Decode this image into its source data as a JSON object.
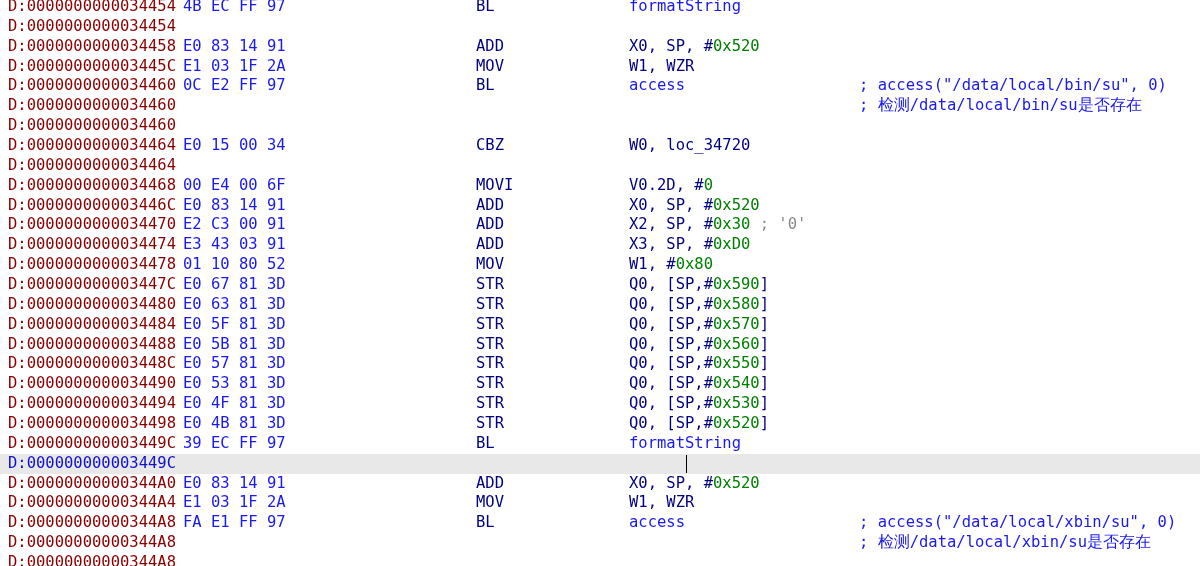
{
  "listing": {
    "rows": [
      {
        "address": "D:0000000000034454",
        "selected": false,
        "bytes": "4B EC FF 97",
        "mnemonic": "BL",
        "operands": [
          {
            "text": "formatString",
            "kind": "name"
          }
        ]
      },
      {
        "address": "D:0000000000034454",
        "selected": false
      },
      {
        "address": "D:0000000000034458",
        "selected": false,
        "bytes": "E0 83 14 91",
        "mnemonic": "ADD",
        "operands": [
          {
            "text": "X0, SP, #",
            "kind": "reg"
          },
          {
            "text": "0x520",
            "kind": "imm"
          }
        ]
      },
      {
        "address": "D:000000000003445C",
        "selected": false,
        "bytes": "E1 03 1F 2A",
        "mnemonic": "MOV",
        "operands": [
          {
            "text": "W1, WZR",
            "kind": "reg"
          }
        ]
      },
      {
        "address": "D:0000000000034460",
        "selected": false,
        "bytes": "0C E2 FF 97",
        "mnemonic": "BL",
        "operands": [
          {
            "text": "access",
            "kind": "name"
          }
        ],
        "comment": "; access(\"/data/local/bin/su\", 0)"
      },
      {
        "address": "D:0000000000034460",
        "selected": false,
        "comment": "; 检测/data/local/bin/su是否存在"
      },
      {
        "address": "D:0000000000034460",
        "selected": false
      },
      {
        "address": "D:0000000000034464",
        "selected": false,
        "bytes": "E0 15 00 34",
        "mnemonic": "CBZ",
        "operands": [
          {
            "text": "W0, loc_34720",
            "kind": "reg"
          }
        ]
      },
      {
        "address": "D:0000000000034464",
        "selected": false
      },
      {
        "address": "D:0000000000034468",
        "selected": false,
        "bytes": "00 E4 00 6F",
        "mnemonic": "MOVI",
        "operands": [
          {
            "text": "V0.2D, #",
            "kind": "reg"
          },
          {
            "text": "0",
            "kind": "imm"
          }
        ]
      },
      {
        "address": "D:000000000003446C",
        "selected": false,
        "bytes": "E0 83 14 91",
        "mnemonic": "ADD",
        "operands": [
          {
            "text": "X0, SP, #",
            "kind": "reg"
          },
          {
            "text": "0x520",
            "kind": "imm"
          }
        ]
      },
      {
        "address": "D:0000000000034470",
        "selected": false,
        "bytes": "E2 C3 00 91",
        "mnemonic": "ADD",
        "operands": [
          {
            "text": "X2, SP, #",
            "kind": "reg"
          },
          {
            "text": "0x30",
            "kind": "imm"
          },
          {
            "text": " ; '0'",
            "kind": "note"
          }
        ]
      },
      {
        "address": "D:0000000000034474",
        "selected": false,
        "bytes": "E3 43 03 91",
        "mnemonic": "ADD",
        "operands": [
          {
            "text": "X3, SP, #",
            "kind": "reg"
          },
          {
            "text": "0xD0",
            "kind": "imm"
          }
        ]
      },
      {
        "address": "D:0000000000034478",
        "selected": false,
        "bytes": "01 10 80 52",
        "mnemonic": "MOV",
        "operands": [
          {
            "text": "W1, #",
            "kind": "reg"
          },
          {
            "text": "0x80",
            "kind": "imm"
          }
        ]
      },
      {
        "address": "D:000000000003447C",
        "selected": false,
        "bytes": "E0 67 81 3D",
        "mnemonic": "STR",
        "operands": [
          {
            "text": "Q0, [SP,#",
            "kind": "reg"
          },
          {
            "text": "0x590",
            "kind": "imm"
          },
          {
            "text": "]",
            "kind": "reg"
          }
        ]
      },
      {
        "address": "D:0000000000034480",
        "selected": false,
        "bytes": "E0 63 81 3D",
        "mnemonic": "STR",
        "operands": [
          {
            "text": "Q0, [SP,#",
            "kind": "reg"
          },
          {
            "text": "0x580",
            "kind": "imm"
          },
          {
            "text": "]",
            "kind": "reg"
          }
        ]
      },
      {
        "address": "D:0000000000034484",
        "selected": false,
        "bytes": "E0 5F 81 3D",
        "mnemonic": "STR",
        "operands": [
          {
            "text": "Q0, [SP,#",
            "kind": "reg"
          },
          {
            "text": "0x570",
            "kind": "imm"
          },
          {
            "text": "]",
            "kind": "reg"
          }
        ]
      },
      {
        "address": "D:0000000000034488",
        "selected": false,
        "bytes": "E0 5B 81 3D",
        "mnemonic": "STR",
        "operands": [
          {
            "text": "Q0, [SP,#",
            "kind": "reg"
          },
          {
            "text": "0x560",
            "kind": "imm"
          },
          {
            "text": "]",
            "kind": "reg"
          }
        ]
      },
      {
        "address": "D:000000000003448C",
        "selected": false,
        "bytes": "E0 57 81 3D",
        "mnemonic": "STR",
        "operands": [
          {
            "text": "Q0, [SP,#",
            "kind": "reg"
          },
          {
            "text": "0x550",
            "kind": "imm"
          },
          {
            "text": "]",
            "kind": "reg"
          }
        ]
      },
      {
        "address": "D:0000000000034490",
        "selected": false,
        "bytes": "E0 53 81 3D",
        "mnemonic": "STR",
        "operands": [
          {
            "text": "Q0, [SP,#",
            "kind": "reg"
          },
          {
            "text": "0x540",
            "kind": "imm"
          },
          {
            "text": "]",
            "kind": "reg"
          }
        ]
      },
      {
        "address": "D:0000000000034494",
        "selected": false,
        "bytes": "E0 4F 81 3D",
        "mnemonic": "STR",
        "operands": [
          {
            "text": "Q0, [SP,#",
            "kind": "reg"
          },
          {
            "text": "0x530",
            "kind": "imm"
          },
          {
            "text": "]",
            "kind": "reg"
          }
        ]
      },
      {
        "address": "D:0000000000034498",
        "selected": false,
        "bytes": "E0 4B 81 3D",
        "mnemonic": "STR",
        "operands": [
          {
            "text": "Q0, [SP,#",
            "kind": "reg"
          },
          {
            "text": "0x520",
            "kind": "imm"
          },
          {
            "text": "]",
            "kind": "reg"
          }
        ]
      },
      {
        "address": "D:000000000003449C",
        "selected": false,
        "bytes": "39 EC FF 97",
        "mnemonic": "BL",
        "operands": [
          {
            "text": "formatString",
            "kind": "name"
          }
        ]
      },
      {
        "address": "D:000000000003449C",
        "selected": true
      },
      {
        "address": "D:00000000000344A0",
        "selected": false,
        "bytes": "E0 83 14 91",
        "mnemonic": "ADD",
        "operands": [
          {
            "text": "X0, SP, #",
            "kind": "reg"
          },
          {
            "text": "0x520",
            "kind": "imm"
          }
        ]
      },
      {
        "address": "D:00000000000344A4",
        "selected": false,
        "bytes": "E1 03 1F 2A",
        "mnemonic": "MOV",
        "operands": [
          {
            "text": "W1, WZR",
            "kind": "reg"
          }
        ]
      },
      {
        "address": "D:00000000000344A8",
        "selected": false,
        "bytes": "FA E1 FF 97",
        "mnemonic": "BL",
        "operands": [
          {
            "text": "access",
            "kind": "name"
          }
        ],
        "comment": "; access(\"/data/local/xbin/su\", 0)"
      },
      {
        "address": "D:00000000000344A8",
        "selected": false,
        "comment": "; 检测/data/local/xbin/su是否存在"
      },
      {
        "address": "D:00000000000344A8",
        "selected": false
      }
    ]
  }
}
